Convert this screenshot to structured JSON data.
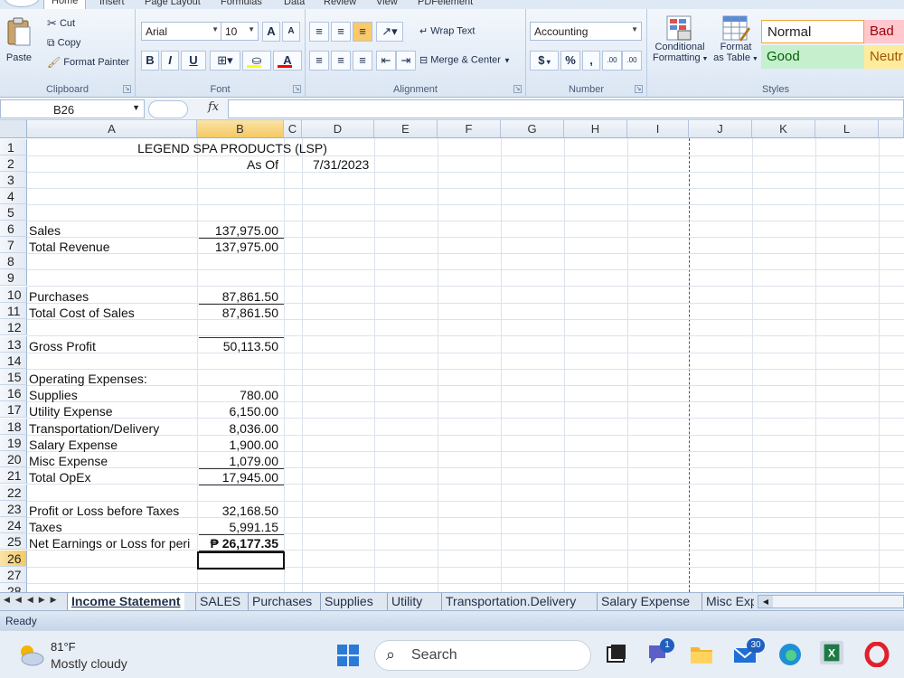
{
  "ribbon": {
    "tabs": [
      "Home",
      "Insert",
      "Page Layout",
      "Formulas",
      "Data",
      "Review",
      "View",
      "PDFelement"
    ],
    "clipboard": {
      "cut": "Cut",
      "copy": "Copy",
      "paste": "Paste",
      "format_painter": "Format Painter",
      "label": "Clipboard"
    },
    "font": {
      "family": "Arial",
      "size": "10",
      "bold": "B",
      "italic": "I",
      "underline": "U",
      "grow": "A",
      "shrink": "A",
      "label": "Font",
      "fill_color": "#ffff00",
      "font_color": "#ff0000"
    },
    "alignment": {
      "wrap_text": "Wrap Text",
      "merge_center": "Merge & Center",
      "label": "Alignment"
    },
    "number": {
      "format": "Accounting",
      "currency": "$",
      "percent": "%",
      "comma": ",",
      "inc_decimal": ".00",
      "dec_decimal": ".00",
      "label": "Number"
    },
    "styles": {
      "conditional": "Conditional",
      "formatting": "Formatting",
      "format": "Format",
      "as_table": "as Table",
      "normal": "Normal",
      "bad": "Bad",
      "good": "Good",
      "neutral": "Neutr",
      "label": "Styles",
      "colors": {
        "bad_bg": "#ffc7ce",
        "bad_fg": "#9c0006",
        "good_bg": "#c6efce",
        "good_fg": "#006100",
        "neutral_bg": "#ffeb9c",
        "neutral_fg": "#9c5700"
      }
    }
  },
  "formula_bar": {
    "name_box": "B26",
    "fx": "fx",
    "content": ""
  },
  "columns": [
    "A",
    "B",
    "C",
    "D",
    "E",
    "F",
    "G",
    "H",
    "I",
    "J",
    "K",
    "L"
  ],
  "rows": [
    "1",
    "2",
    "3",
    "4",
    "5",
    "6",
    "7",
    "8",
    "9",
    "10",
    "11",
    "12",
    "13",
    "14",
    "15",
    "16",
    "17",
    "18",
    "19",
    "20",
    "21",
    "22",
    "23",
    "24",
    "25",
    "26",
    "27",
    "28"
  ],
  "cells": {
    "r1": "LEGEND SPA PRODUCTS (LSP)",
    "r2_b": "As Of",
    "r2_d": "7/31/2023",
    "r6_a": "Sales",
    "r6_b": "137,975.00",
    "r7_a": "Total Revenue",
    "r7_b": "137,975.00",
    "r10_a": "Purchases",
    "r10_b": "87,861.50",
    "r11_a": "Total Cost of Sales",
    "r11_b": "87,861.50",
    "r13_a": "Gross Profit",
    "r13_b": "50,113.50",
    "r15_a": "Operating Expenses:",
    "r16_a": "Supplies",
    "r16_b": "780.00",
    "r17_a": "Utility Expense",
    "r17_b": "6,150.00",
    "r18_a": "Transportation/Delivery",
    "r18_b": "8,036.00",
    "r19_a": "Salary Expense",
    "r19_b": "1,900.00",
    "r20_a": "Misc Expense",
    "r20_b": "1,079.00",
    "r21_a": "Total OpEx",
    "r21_b": "17,945.00",
    "r23_a": "Profit or Loss before Taxes",
    "r23_b": "32,168.50",
    "r24_a": "Taxes",
    "r24_b": "5,991.15",
    "r25_a": "Net Earnings or Loss for peri",
    "r25_b": "₱ 26,177.35"
  },
  "sheets": [
    "Income Statement",
    "SALES",
    "Purchases",
    "Supplies",
    "Utility",
    "Transportation.Delivery",
    "Salary Expense",
    "Misc Exp"
  ],
  "status": "Ready",
  "taskbar": {
    "temp": "81°F",
    "weather": "Mostly cloudy",
    "search": "Search",
    "teams_badge": "1",
    "mail_badge": "30"
  }
}
